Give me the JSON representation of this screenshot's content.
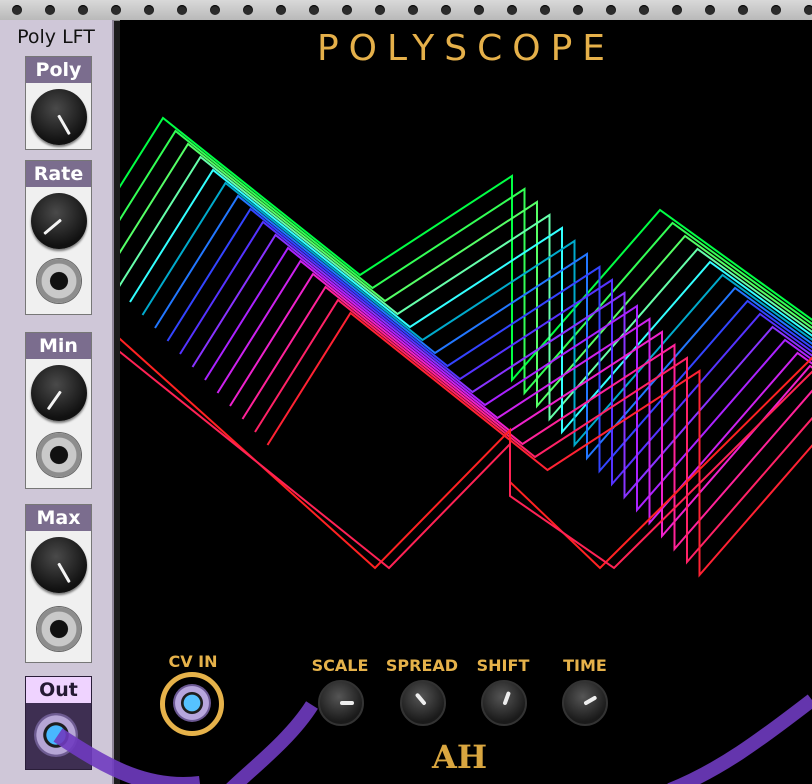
{
  "left_module": {
    "title": "Poly LFT",
    "sections": [
      {
        "label": "Poly"
      },
      {
        "label": "Rate"
      },
      {
        "label": "Min"
      },
      {
        "label": "Max"
      },
      {
        "label": "Out"
      }
    ]
  },
  "scope": {
    "title": "POLYSCOPE",
    "cv_label": "CV IN",
    "knobs": [
      {
        "label": "SCALE"
      },
      {
        "label": "SPREAD"
      },
      {
        "label": "SHIFT"
      },
      {
        "label": "TIME"
      }
    ],
    "logo": "AH"
  },
  "colors": {
    "scope_text": "#e6b24a",
    "panel_header": "#7b6d8e",
    "cable": "#7a3fc9"
  }
}
